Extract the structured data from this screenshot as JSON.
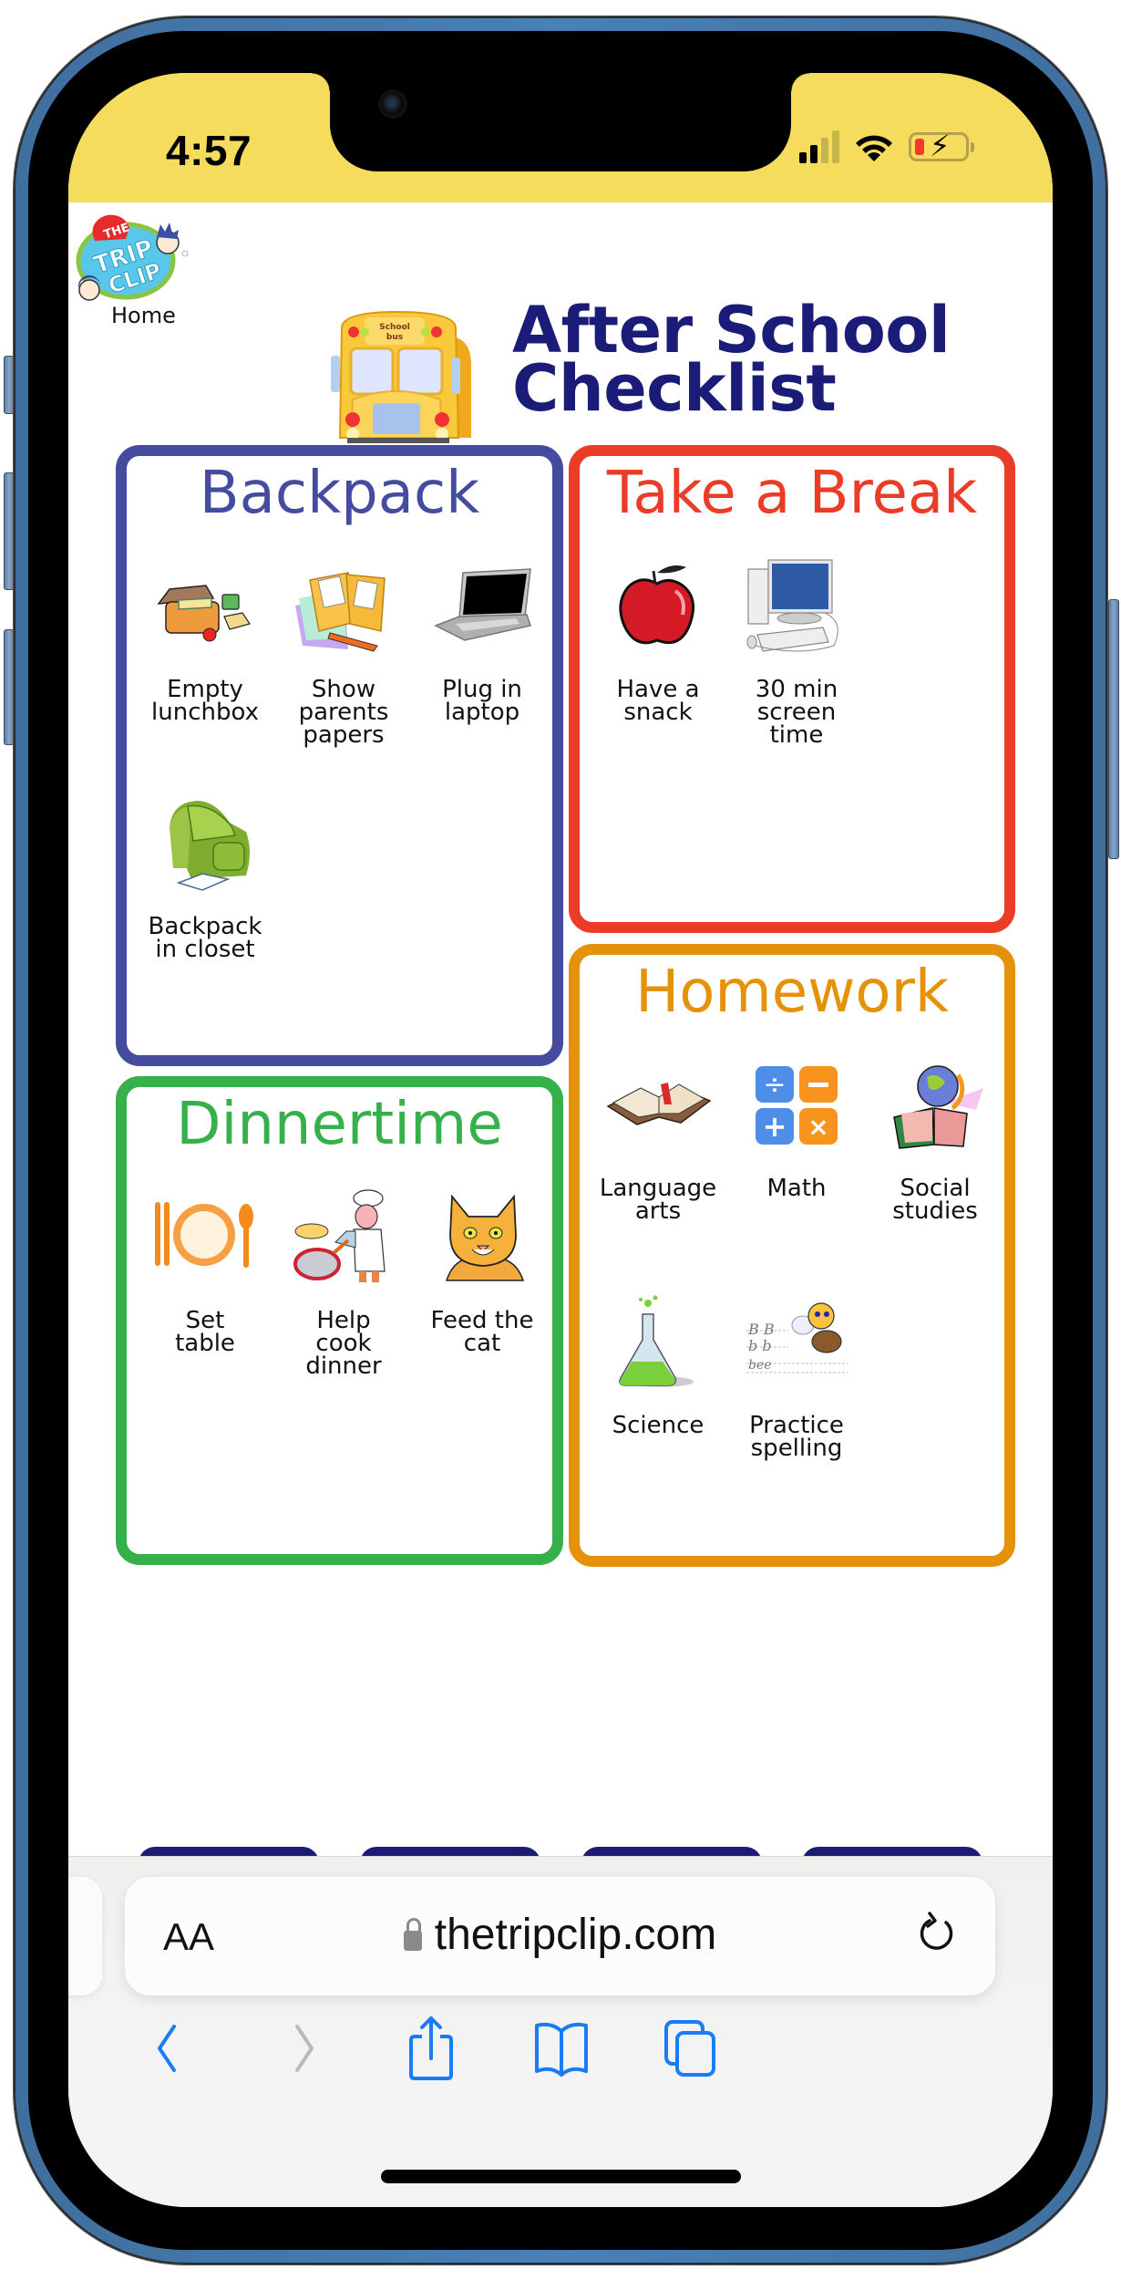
{
  "status_bar": {
    "time": "4:57",
    "signal_bars_active": 2,
    "signal_bars_total": 4,
    "battery_state": "charging-low",
    "icons": [
      "cellular-signal-icon",
      "wifi-icon",
      "battery-charging-icon"
    ]
  },
  "site": {
    "logo_alt": "The Trip Clip",
    "logo_text_top": "THE",
    "logo_text_mid": "TRIP",
    "logo_text_bottom": "CLIP",
    "home_link": "Home",
    "title_line1": "After School",
    "title_line2": "Checklist",
    "bus_sign_line1": "School",
    "bus_sign_line2": "bus"
  },
  "sections": [
    {
      "title": "Backpack",
      "color": "#454B9F",
      "items": [
        {
          "label": "Empty\nlunchbox",
          "icon": "lunchbox-icon"
        },
        {
          "label": "Show\nparents\npapers",
          "icon": "papers-folder-icon"
        },
        {
          "label": "Plug in\nlaptop",
          "icon": "laptop-icon"
        },
        {
          "label": "Backpack\nin closet",
          "icon": "backpack-icon"
        }
      ]
    },
    {
      "title": "Take a Break",
      "color": "#EB3C27",
      "items": [
        {
          "label": "Have a\nsnack",
          "icon": "apple-icon"
        },
        {
          "label": "30 min\nscreen\ntime",
          "icon": "desktop-computer-icon"
        }
      ]
    },
    {
      "title": "Dinnertime",
      "color": "#36B04A",
      "items": [
        {
          "label": "Set\ntable",
          "icon": "plate-cutlery-icon"
        },
        {
          "label": "Help\ncook\ndinner",
          "icon": "chef-icon"
        },
        {
          "label": "Feed the\ncat",
          "icon": "cat-icon"
        }
      ]
    },
    {
      "title": "Homework",
      "color": "#E59109",
      "items": [
        {
          "label": "Language\narts",
          "icon": "open-book-icon"
        },
        {
          "label": "Math",
          "icon": "math-operators-icon"
        },
        {
          "label": "Social\nstudies",
          "icon": "globe-book-icon"
        },
        {
          "label": "Science",
          "icon": "flask-icon"
        },
        {
          "label": "Practice\nspelling",
          "icon": "spelling-bee-icon"
        }
      ]
    }
  ],
  "browser": {
    "text_size_label": "AA",
    "url": "thetripclip.com",
    "secure": true,
    "buttons": {
      "back": "back-icon",
      "forward": "forward-icon",
      "share": "share-icon",
      "bookmarks": "bookmarks-icon",
      "tabs": "tabs-icon",
      "reload": "reload-icon"
    },
    "forward_enabled": false
  },
  "colors": {
    "status_bar_bg": "#F6DC5C",
    "title": "#1B1B78",
    "ios_blue": "#1A7CF5",
    "tabs_peek": "#1C1C78"
  }
}
